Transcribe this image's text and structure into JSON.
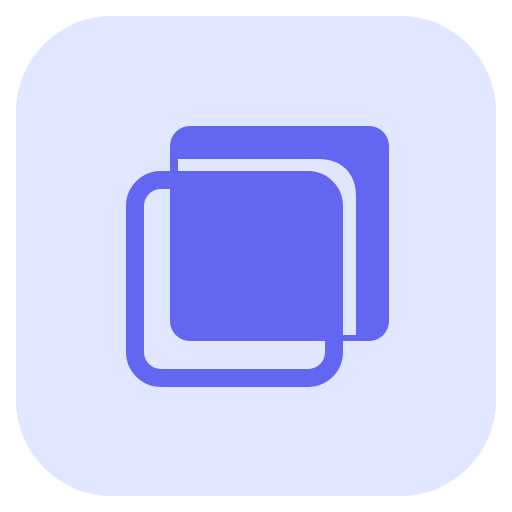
{
  "icon": {
    "name": "copy-icon",
    "tile_color": "#e0e7ff",
    "accent_color": "#6366f1"
  }
}
